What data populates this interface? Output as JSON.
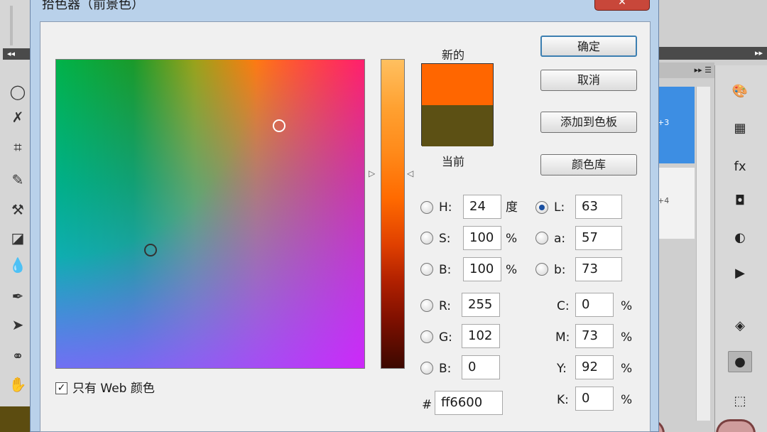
{
  "dialog": {
    "title": "拾色器（前景色）",
    "close_label": "✕"
  },
  "workspace": {
    "left_collapse": "◂◂",
    "right_collapse": "▸▸",
    "panel_menu": "▸▸ ☰",
    "layer_shortcut_1": "+3",
    "layer_shortcut_2": "+4",
    "left_tools": [
      "◯",
      "✗",
      "⌗",
      "✎",
      "⚒",
      "◪",
      "💧",
      "✒",
      "➤",
      "⚭",
      "✋"
    ],
    "right_icons": [
      "🎨",
      "▦",
      "fx",
      "◘",
      "◐",
      "▶",
      "◈",
      "●",
      "⬚"
    ]
  },
  "preview": {
    "new_label": "新的",
    "current_label": "当前",
    "new_color": "#ff6600",
    "current_color": "#5c5014"
  },
  "buttons": {
    "ok": "确定",
    "cancel": "取消",
    "add_swatch": "添加到色板",
    "color_libraries": "颜色库"
  },
  "hsb": {
    "h_label": "H:",
    "h_value": "24",
    "h_unit": "度",
    "s_label": "S:",
    "s_value": "100",
    "s_unit": "%",
    "b_label": "B:",
    "b_value": "100",
    "b_unit": "%"
  },
  "lab": {
    "l_label": "L:",
    "l_value": "63",
    "a_label": "a:",
    "a_value": "57",
    "b_label": "b:",
    "b_value": "73"
  },
  "rgb": {
    "r_label": "R:",
    "r_value": "255",
    "g_label": "G:",
    "g_value": "102",
    "b_label": "B:",
    "b_value": "0"
  },
  "cmyk": {
    "c_label": "C:",
    "c_value": "0",
    "m_label": "M:",
    "m_value": "73",
    "y_label": "Y:",
    "y_value": "92",
    "k_label": "K:",
    "k_value": "0",
    "unit": "%"
  },
  "hex": {
    "label": "#",
    "value": "ff6600"
  },
  "web_only": {
    "label": "只有 Web 颜色",
    "checked": true,
    "check_mark": "✓"
  },
  "selected_mode": "L"
}
